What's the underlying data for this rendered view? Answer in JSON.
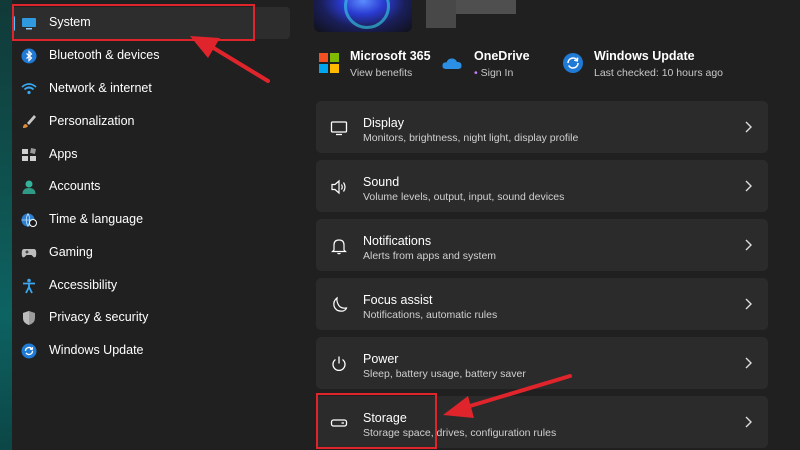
{
  "sidebar": {
    "items": [
      {
        "label": "System",
        "icon": "display-icon",
        "selected": true
      },
      {
        "label": "Bluetooth & devices",
        "icon": "bluetooth-icon"
      },
      {
        "label": "Network & internet",
        "icon": "wifi-icon"
      },
      {
        "label": "Personalization",
        "icon": "brush-icon"
      },
      {
        "label": "Apps",
        "icon": "apps-icon"
      },
      {
        "label": "Accounts",
        "icon": "person-icon"
      },
      {
        "label": "Time & language",
        "icon": "globe-clock-icon"
      },
      {
        "label": "Gaming",
        "icon": "gamepad-icon"
      },
      {
        "label": "Accessibility",
        "icon": "accessibility-icon"
      },
      {
        "label": "Privacy & security",
        "icon": "shield-icon"
      },
      {
        "label": "Windows Update",
        "icon": "update-icon"
      }
    ]
  },
  "quick_links": [
    {
      "title": "Microsoft 365",
      "subtitle": "View benefits",
      "icon": "microsoft-logo-icon"
    },
    {
      "title": "OneDrive",
      "subtitle": "Sign In",
      "icon": "onedrive-cloud-icon"
    },
    {
      "title": "Windows Update",
      "subtitle": "Last checked: 10 hours ago",
      "icon": "update-icon"
    }
  ],
  "settings": [
    {
      "title": "Display",
      "subtitle": "Monitors, brightness, night light, display profile",
      "icon": "monitor-icon"
    },
    {
      "title": "Sound",
      "subtitle": "Volume levels, output, input, sound devices",
      "icon": "speaker-icon"
    },
    {
      "title": "Notifications",
      "subtitle": "Alerts from apps and system",
      "icon": "bell-icon"
    },
    {
      "title": "Focus assist",
      "subtitle": "Notifications, automatic rules",
      "icon": "moon-icon"
    },
    {
      "title": "Power",
      "subtitle": "Sleep, battery usage, battery saver",
      "icon": "power-icon"
    },
    {
      "title": "Storage",
      "subtitle": "Storage space, drives, configuration rules",
      "icon": "drive-icon"
    }
  ],
  "colors": {
    "background": "#202020",
    "card": "#2b2b2b",
    "accent": "#4cc2ff",
    "highlight": "#e0242b"
  }
}
